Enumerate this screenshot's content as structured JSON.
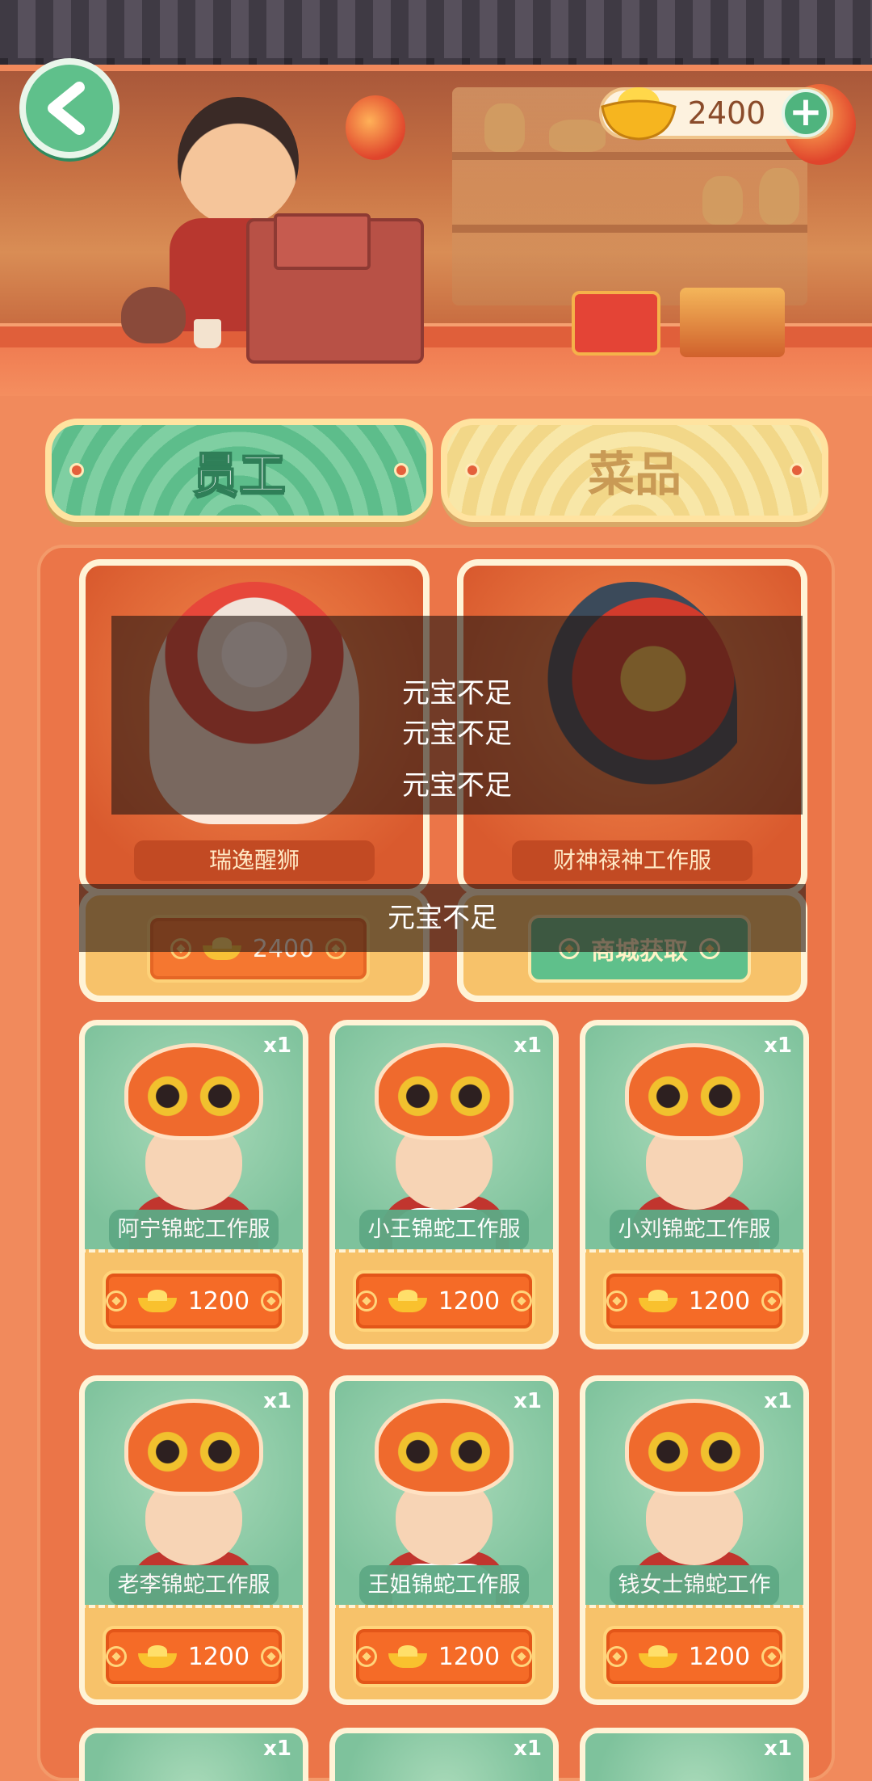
{
  "header": {
    "gold_amount": "2400",
    "plus_label": "+"
  },
  "tabs": [
    {
      "label": "员工",
      "active": true
    },
    {
      "label": "菜品",
      "active": false
    }
  ],
  "featured": [
    {
      "name": "瑞逸醒狮",
      "price": "2400",
      "action": "price"
    },
    {
      "name": "财神禄神工作服",
      "action_label": "商城获取",
      "action": "shop"
    }
  ],
  "staff": [
    {
      "name": "阿宁锦蛇工作服",
      "qty": "x1",
      "price": "1200"
    },
    {
      "name": "小王锦蛇工作服",
      "qty": "x1",
      "price": "1200"
    },
    {
      "name": "小刘锦蛇工作服",
      "qty": "x1",
      "price": "1200"
    },
    {
      "name": "老李锦蛇工作服",
      "qty": "x1",
      "price": "1200"
    },
    {
      "name": "王姐锦蛇工作服",
      "qty": "x1",
      "price": "1200"
    },
    {
      "name": "钱女士锦蛇工作服",
      "qty": "x1",
      "price": "1200"
    }
  ],
  "peek": [
    {
      "qty": "x1"
    },
    {
      "qty": "x1"
    },
    {
      "qty": "x1"
    }
  ],
  "toasts": [
    "元宝不足",
    "元宝不足",
    "元宝不足",
    "元宝不足"
  ],
  "colors": {
    "accent_green": "#5fc08b",
    "accent_orange": "#f56b27",
    "panel": "#eb7548"
  }
}
